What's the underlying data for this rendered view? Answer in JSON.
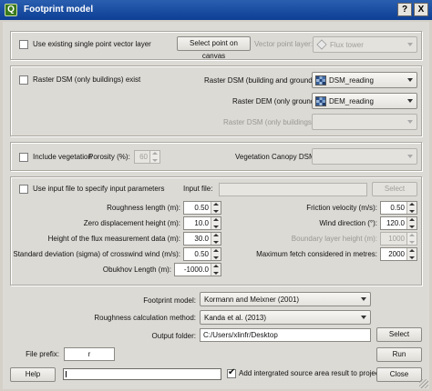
{
  "window": {
    "title": "Footprint model",
    "help_btn": "?",
    "close_btn": "X"
  },
  "point_group": {
    "checkbox_label": "Use existing single point vector layer",
    "select_point_btn": "Select point on canvas",
    "vector_layer_label": "Vector point layer:",
    "vector_layer_value": "Flux tower"
  },
  "dsm_group": {
    "checkbox_label": "Raster DSM (only buildings) exist",
    "dsm_label": "Raster DSM (building and ground):",
    "dsm_value": "DSM_reading",
    "dem_label": "Raster DEM (only ground):",
    "dem_value": "DEM_reading",
    "dsm_buildings_label": "Raster DSM (only buildings):"
  },
  "veg_group": {
    "checkbox_label": "Include vegetation",
    "porosity_label": "Porosity (%):",
    "porosity_value": "60",
    "canopy_label": "Vegetation Canopy DSM:"
  },
  "input_group": {
    "checkbox_label": "Use input file to specify input parameters",
    "input_file_label": "Input file:",
    "select_btn": "Select",
    "roughness_label": "Roughness length (m):",
    "roughness_value": "0.50",
    "zero_disp_label": "Zero displacement height (m):",
    "zero_disp_value": "10.0",
    "flux_height_label": "Height of the flux measurement data (m):",
    "flux_height_value": "30.0",
    "sigma_label": "Standard deviation (sigma) of crosswind wind (m/s):",
    "sigma_value": "0.50",
    "obukhov_label": "Obukhov Length (m):",
    "obukhov_value": "-1000.0",
    "friction_label": "Friction velocity (m/s):",
    "friction_value": "0.50",
    "wind_dir_label": "Wind direction (°):",
    "wind_dir_value": "120.0",
    "boundary_label": "Boundary layer height (m):",
    "boundary_value": "1000",
    "max_fetch_label": "Maximum fetch considered in metres:",
    "max_fetch_value": "2000"
  },
  "model_group": {
    "footprint_model_label": "Footprint model:",
    "footprint_model_value": "Kormann and Meixner (2001)",
    "roughness_method_label": "Roughness calculation method:",
    "roughness_method_value": "Kanda et al. (2013)",
    "output_folder_label": "Output folder:",
    "output_folder_value": "C:/Users/xlinfr/Desktop",
    "select_btn": "Select"
  },
  "bottom": {
    "file_prefix_label": "File prefix:",
    "file_prefix_value": "r",
    "run_btn": "Run",
    "help_btn": "Help",
    "add_result_label": "Add intergrated source area result to project",
    "close_btn": "Close"
  }
}
